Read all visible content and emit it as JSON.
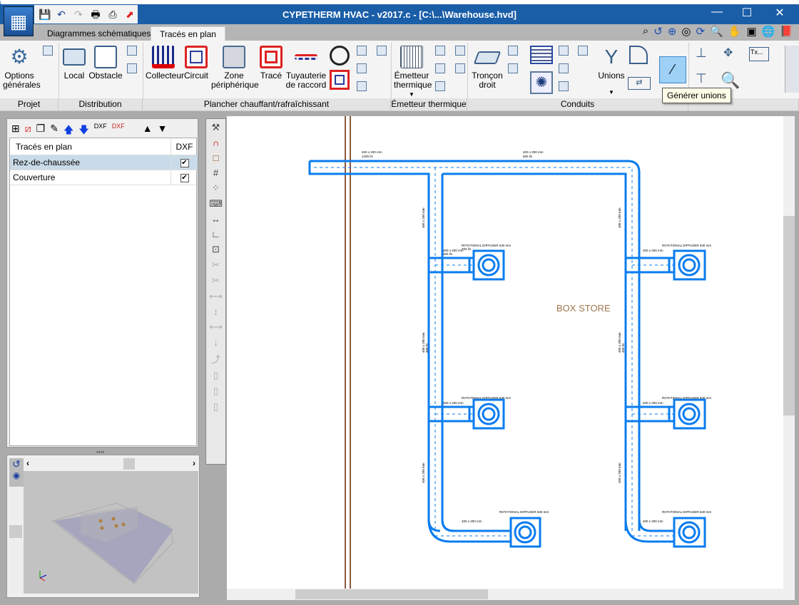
{
  "window": {
    "title": "CYPETHERM HVAC - v2017.c - [C:\\...\\Warehouse.hvd]",
    "minimize": "—",
    "maximize": "☐",
    "close": "✕"
  },
  "tabs": [
    {
      "label": "Diagrammes schématiques",
      "active": false
    },
    {
      "label": "Tracés en plan",
      "active": true
    }
  ],
  "ribbon": {
    "groups": [
      "Projet",
      "Distribution",
      "Plancher chauffant/rafraîchissant",
      "Émetteur thermique",
      "Conduits"
    ],
    "buttons": {
      "options": "Options\ngénérales",
      "local": "Local",
      "obstacle": "Obstacle",
      "collecteur": "Collecteur",
      "circuit": "Circuit",
      "zone": "Zone\npériphérique",
      "trace": "Tracé",
      "tuyauterie": "Tuyauterie\nde raccord",
      "emetteur": "Émetteur\nthermique",
      "troncon": "Tronçon\ndroit",
      "unions": "Unions"
    },
    "tooltip": "Générer unions"
  },
  "layers": {
    "header": "Tracés en plan",
    "dxf_header": "DXF",
    "rows": [
      {
        "name": "Rez-de-chaussée",
        "dxf": true,
        "selected": true
      },
      {
        "name": "Couverture",
        "dxf": true,
        "selected": false
      }
    ]
  },
  "plan": {
    "room_label": "BOX STORE",
    "duct_main": [
      "1",
      "400 x 200 mm",
      "1200 l/s"
    ],
    "duct_main2": [
      "1",
      "400 x 200 mm",
      "600 l/s"
    ],
    "duct_vert": [
      "1",
      "400 x 200 mm",
      "600 l/s"
    ],
    "duct_vert2": [
      "1",
      "400 x 200 mm",
      "400 l/s"
    ],
    "duct_vert3": [
      "1",
      "400 x 200 mm",
      "200 l/s"
    ],
    "branch": [
      "1",
      "400 x 200 mm",
      "200 l/s"
    ],
    "diffuser": [
      "2",
      "ROTATIONAL DIFFUSER 630 mm",
      "200 l/s"
    ]
  },
  "colors": {
    "titlebar": "#1a5ea8",
    "duct": "#0a7cf0",
    "wall": "#8b5a3c",
    "room_label": "#a07850"
  }
}
